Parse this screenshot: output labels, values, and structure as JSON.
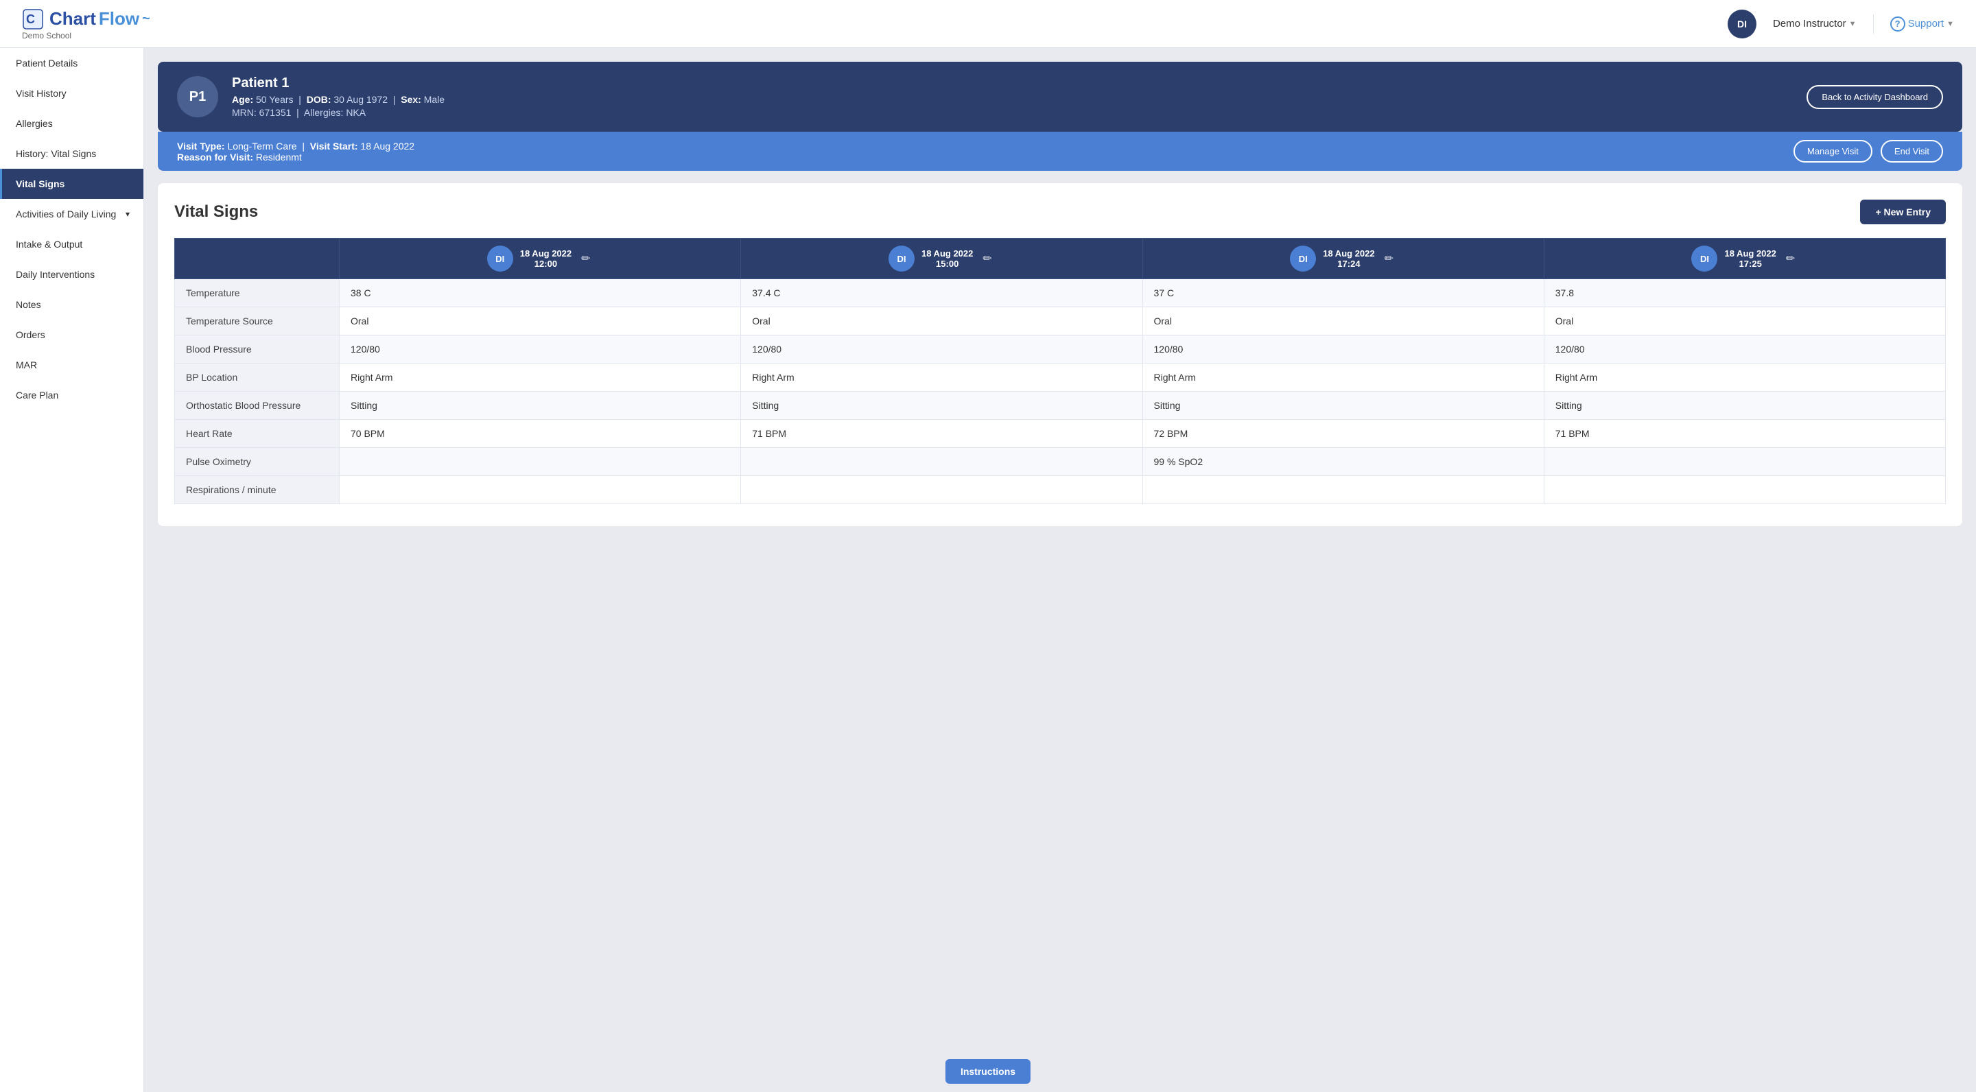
{
  "app": {
    "logo_text": "Chart",
    "logo_flow": "Flow",
    "school": "Demo School",
    "avatar": "DI",
    "user_name": "Demo Instructor",
    "support_label": "Support"
  },
  "sidebar": {
    "items": [
      {
        "id": "patient-details",
        "label": "Patient Details",
        "active": false
      },
      {
        "id": "visit-history",
        "label": "Visit History",
        "active": false
      },
      {
        "id": "allergies",
        "label": "Allergies",
        "active": false
      },
      {
        "id": "history-vital-signs",
        "label": "History: Vital Signs",
        "active": false
      },
      {
        "id": "vital-signs",
        "label": "Vital Signs",
        "active": true,
        "expandable": false
      },
      {
        "id": "activities-daily-living",
        "label": "Activities of Daily Living",
        "active": false,
        "expandable": true
      },
      {
        "id": "intake-output",
        "label": "Intake & Output",
        "active": false
      },
      {
        "id": "daily-interventions",
        "label": "Daily Interventions",
        "active": false
      },
      {
        "id": "notes",
        "label": "Notes",
        "active": false
      },
      {
        "id": "orders",
        "label": "Orders",
        "active": false
      },
      {
        "id": "mar",
        "label": "MAR",
        "active": false
      },
      {
        "id": "care-plan",
        "label": "Care Plan",
        "active": false
      }
    ]
  },
  "patient": {
    "initials": "P1",
    "name": "Patient 1",
    "age_label": "Age:",
    "age": "50 Years",
    "dob_label": "DOB:",
    "dob": "30 Aug 1972",
    "sex_label": "Sex:",
    "sex": "Male",
    "mrn_label": "MRN:",
    "mrn": "671351",
    "allergies_label": "Allergies:",
    "allergies": "NKA",
    "back_button": "Back to Activity Dashboard"
  },
  "visit": {
    "type_label": "Visit Type:",
    "type": "Long-Term Care",
    "start_label": "Visit Start:",
    "start": "18 Aug 2022",
    "reason_label": "Reason for Visit:",
    "reason": "Residenmt",
    "manage_btn": "Manage Visit",
    "end_btn": "End Visit"
  },
  "vitals": {
    "title": "Vital Signs",
    "new_entry_btn": "+ New Entry",
    "columns": [
      {
        "avatar": "DI",
        "date": "18 Aug 2022",
        "time": "12:00"
      },
      {
        "avatar": "DI",
        "date": "18 Aug 2022",
        "time": "15:00"
      },
      {
        "avatar": "DI",
        "date": "18 Aug 2022",
        "time": "17:24"
      },
      {
        "avatar": "DI",
        "date": "18 Aug 2022",
        "time": "17:25"
      }
    ],
    "rows": [
      {
        "label": "Temperature",
        "values": [
          "38 C",
          "37.4 C",
          "37 C",
          "37.8"
        ]
      },
      {
        "label": "Temperature Source",
        "values": [
          "Oral",
          "Oral",
          "Oral",
          "Oral"
        ]
      },
      {
        "label": "Blood Pressure",
        "values": [
          "120/80",
          "120/80",
          "120/80",
          "120/80"
        ]
      },
      {
        "label": "BP Location",
        "values": [
          "Right Arm",
          "Right Arm",
          "Right Arm",
          "Right Arm"
        ]
      },
      {
        "label": "Orthostatic Blood Pressure",
        "values": [
          "Sitting",
          "Sitting",
          "Sitting",
          "Sitting"
        ]
      },
      {
        "label": "Heart Rate",
        "values": [
          "70 BPM",
          "71 BPM",
          "72 BPM",
          "71 BPM"
        ]
      },
      {
        "label": "Pulse Oximetry",
        "values": [
          "",
          "",
          "99 % SpO2",
          ""
        ]
      },
      {
        "label": "Respirations / minute",
        "values": [
          "",
          "",
          "",
          ""
        ]
      }
    ]
  },
  "instructions": {
    "btn_label": "Instructions"
  }
}
